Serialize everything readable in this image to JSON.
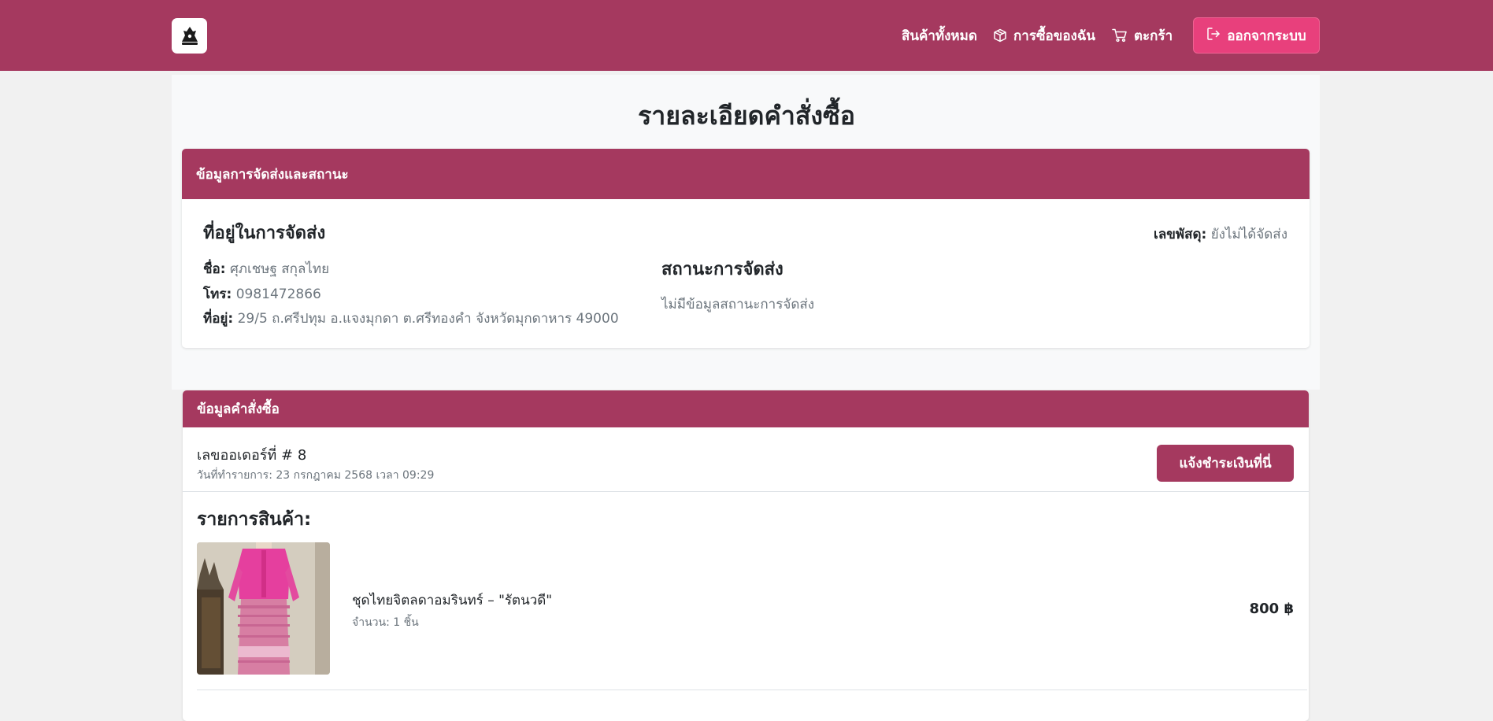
{
  "header": {
    "nav": {
      "all_products": "สินค้าทั้งหมด",
      "my_orders": "การซื้อของฉัน",
      "cart": "ตะกร้า",
      "logout": "ออกจากระบบ"
    },
    "icons": [
      "logo-icon",
      "box-icon",
      "cart-icon",
      "logout-icon"
    ]
  },
  "page": {
    "title": "รายละเอียดคำสั่งซื้อ"
  },
  "shipping": {
    "header": "ข้อมูลการจัดส่งและสถานะ",
    "address_title": "ที่อยู่ในการจัดส่ง",
    "name_label": "ชื่อ:",
    "name_value": "ศุภเชษฐ สกุลไทย",
    "phone_label": "โทร:",
    "phone_value": "0981472866",
    "address_label": "ที่อยู่:",
    "address_value": "29/5 ถ.ศรีปทุม อ.แจงมุกดา ต.ศรีทองคำ จังหวัดมุกดาหาร 49000",
    "tracking_label": "เลขพัสดุ:",
    "tracking_value": "ยังไม่ได้จัดส่ง",
    "status_title": "สถานะการจัดส่ง",
    "status_text": "ไม่มีข้อมูลสถานะการจัดส่ง"
  },
  "order": {
    "header": "ข้อมูลคำสั่งซื้อ",
    "number": "เลขออเดอร์ที่ # 8",
    "date": "วันที่ทำรายการ: 23 กรกฎาคม 2568 เวลา 09:29",
    "pay_button": "แจ้งชำระเงินที่นี่",
    "items_title": "รายการสินค้า:",
    "items": [
      {
        "name": "ชุดไทยจิตลดาอมรินทร์ – \"รัตนวดี\"",
        "quantity": "จำนวน: 1 ชิ้น",
        "price": "800 ฿"
      }
    ]
  },
  "colors": {
    "brand": "#a5395f",
    "logout_button": "#e8407c",
    "panel": "#f8f9fa",
    "background": "#f1f1f1"
  }
}
